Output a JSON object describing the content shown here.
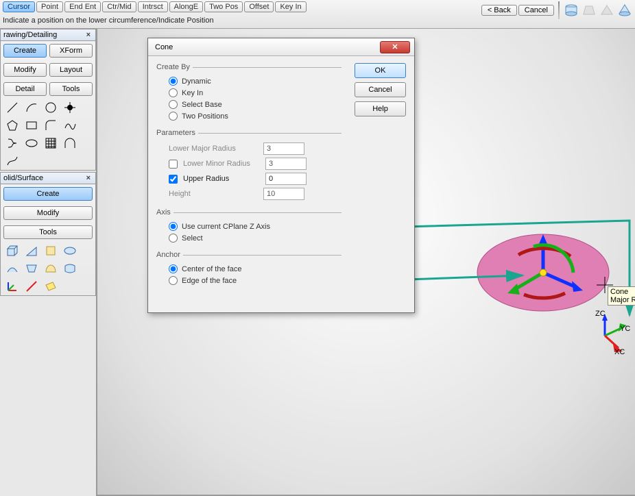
{
  "top": {
    "snap": [
      "Cursor",
      "Point",
      "End Ent",
      "Ctr/Mid",
      "Intrsct",
      "AlongE",
      "Two Pos",
      "Offset",
      "Key In"
    ],
    "active_snap_index": 0,
    "back": "< Back",
    "cancel": "Cancel",
    "prompt": "Indicate a position on the lower circumference/Indicate Position"
  },
  "shape_icons": [
    "cylinder-icon",
    "truncated-cone-icon",
    "pyramid-icon",
    "cone-icon"
  ],
  "panels": {
    "drawing": {
      "title": "rawing/Detailing",
      "buttons": [
        [
          "Create",
          "XForm"
        ],
        [
          "Modify",
          "Layout"
        ],
        [
          "Detail",
          "Tools"
        ]
      ],
      "active": "Create"
    },
    "solid": {
      "title": "olid/Surface",
      "buttons": [
        "Create",
        "Modify",
        "Tools"
      ],
      "active": "Create"
    }
  },
  "dialog": {
    "title": "Cone",
    "ok": "OK",
    "cancel": "Cancel",
    "help": "Help",
    "create_by": {
      "legend": "Create By",
      "options": [
        "Dynamic",
        "Key In",
        "Select Base",
        "Two Positions"
      ],
      "selected": 0
    },
    "parameters": {
      "legend": "Parameters",
      "lower_major": {
        "label": "Lower Major Radius",
        "value": "3",
        "enabled": false
      },
      "lower_minor": {
        "label": "Lower Minor Radius",
        "value": "3",
        "checked": false
      },
      "upper_radius": {
        "label": "Upper Radius",
        "value": "0",
        "checked": true
      },
      "height": {
        "label": "Height",
        "value": "10",
        "enabled": false
      }
    },
    "axis": {
      "legend": "Axis",
      "options": [
        "Use current CPlane Z Axis",
        "Select"
      ],
      "selected": 0
    },
    "anchor": {
      "legend": "Anchor",
      "options": [
        "Center of the face",
        "Edge of the face"
      ],
      "selected": 0
    }
  },
  "viewport": {
    "tooltip_line1": "Cone",
    "tooltip_line2": "Major R",
    "axis_zc": "ZC",
    "axis_yc": "YC",
    "axis_xc": "XC"
  },
  "colors": {
    "accent": "#19a58f",
    "pink": "#e07fb3"
  }
}
